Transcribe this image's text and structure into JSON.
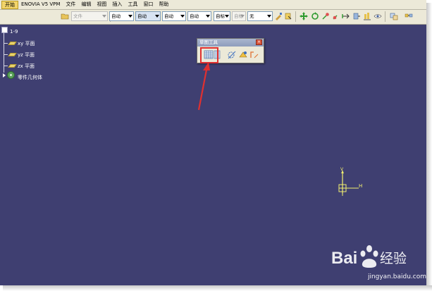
{
  "menu": [
    {
      "label": "开始"
    },
    {
      "label": "ENOVIA V5 VPM"
    },
    {
      "label": "文件"
    },
    {
      "label": "编辑"
    },
    {
      "label": "视图"
    },
    {
      "label": "插入"
    },
    {
      "label": "工具"
    },
    {
      "label": "窗口"
    },
    {
      "label": "帮助"
    }
  ],
  "toolbar": {
    "dropdowns": [
      {
        "value": "文件",
        "disabled": true
      },
      {
        "value": "自动",
        "disabled": false
      },
      {
        "value": "自动",
        "disabled": false
      },
      {
        "value": "自动",
        "disabled": false
      },
      {
        "value": "自动",
        "disabled": false
      },
      {
        "value": "自标",
        "disabled": false
      },
      {
        "value": "自标",
        "disabled": true
      },
      {
        "value": "无",
        "disabled": false
      }
    ]
  },
  "tree": {
    "root": "1-9",
    "items": [
      "xy 平面",
      "yz 平面",
      "zx 平面",
      "零件几何体"
    ]
  },
  "floating_toolbar": {
    "title": "草图工具",
    "close_label": "×"
  },
  "axis": {
    "h_label": "H",
    "v_label": "V"
  },
  "watermark": {
    "text": "Bai 经验",
    "url": "jingyan.baidu.com"
  },
  "colors": {
    "background": "#3f3f71",
    "highlight": "#e03030",
    "axis": "#f2ef70"
  }
}
